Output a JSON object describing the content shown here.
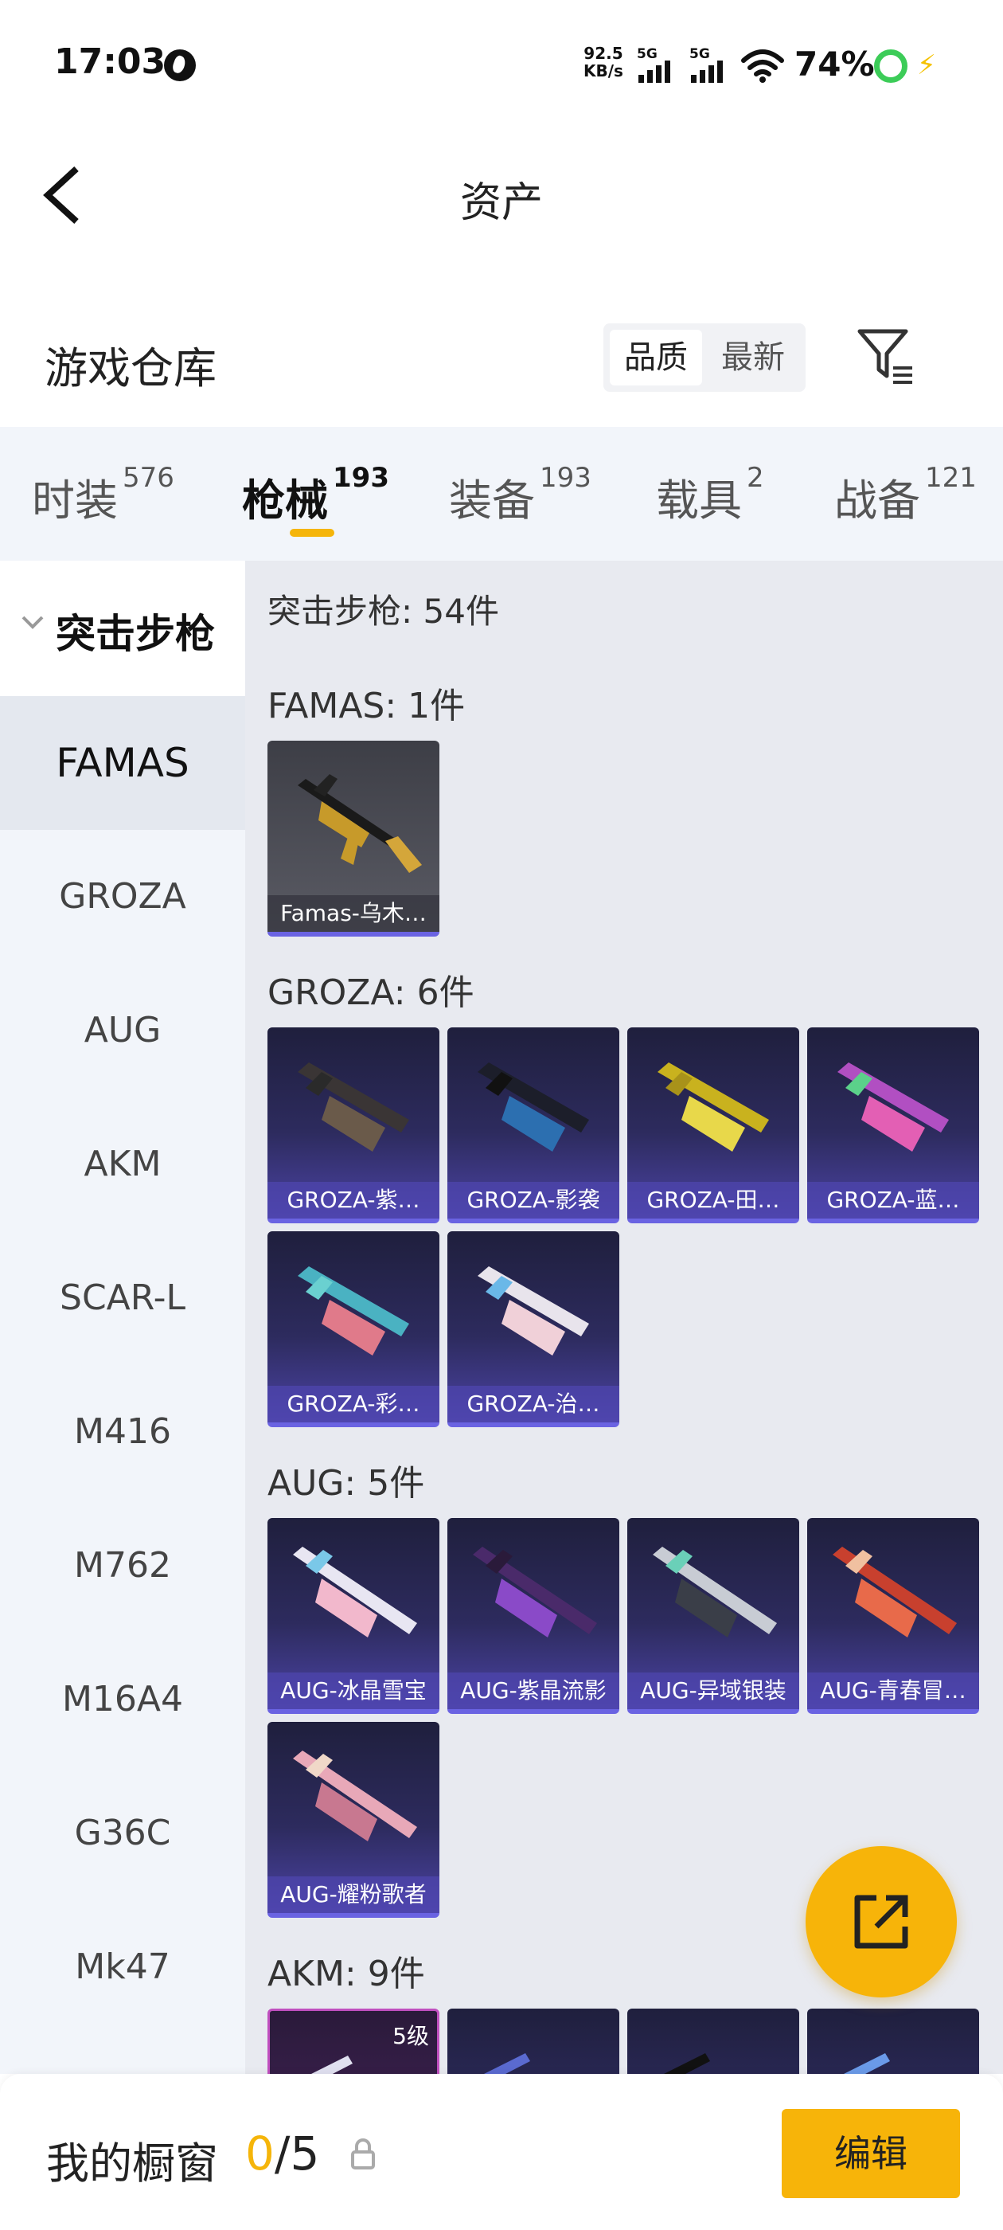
{
  "status_bar": {
    "time": "17:03",
    "net_speed": "92.5",
    "net_unit": "KB/s",
    "signal_1_tag": "5G",
    "signal_2_tag": "5G",
    "battery": "74%"
  },
  "header": {
    "title": "资产"
  },
  "warehouse": {
    "title": "游戏仓库",
    "sort_options": [
      "品质",
      "最新"
    ]
  },
  "tabs": [
    {
      "label": "时装",
      "count": "576"
    },
    {
      "label": "枪械",
      "count": "193"
    },
    {
      "label": "装备",
      "count": "193"
    },
    {
      "label": "载具",
      "count": "2"
    },
    {
      "label": "战备",
      "count": "121"
    }
  ],
  "sidebar": {
    "category": "突击步枪",
    "items": [
      "FAMAS",
      "GROZA",
      "AUG",
      "AKM",
      "SCAR-L",
      "M416",
      "M762",
      "M16A4",
      "G36C",
      "Mk47"
    ]
  },
  "content": {
    "summary": "突击步枪: 54件",
    "groups": [
      {
        "title": "FAMAS: 1件",
        "cards": [
          "Famas-乌木…"
        ]
      },
      {
        "title": "GROZA: 6件",
        "cards": [
          "GROZA-紫…",
          "GROZA-影袭",
          "GROZA-田…",
          "GROZA-蓝…",
          "GROZA-彩…",
          "GROZA-治…"
        ]
      },
      {
        "title": "AUG: 5件",
        "cards": [
          "AUG-冰晶雪宝",
          "AUG-紫晶流影",
          "AUG-异域银装",
          "AUG-青春冒…",
          "AUG-耀粉歌者"
        ]
      },
      {
        "title": "AKM: 9件",
        "first_card_level": "5级"
      }
    ]
  },
  "bottom_bar": {
    "title": "我的橱窗",
    "current": "0",
    "total": "/5",
    "edit_label": "编辑"
  },
  "colors": {
    "accent": "#f7b409",
    "card_border": "#6a63e2"
  },
  "icons": [
    "back-arrow-icon",
    "filter-icon",
    "share-icon",
    "lock-icon",
    "chevron-down-icon",
    "wifi-icon"
  ]
}
